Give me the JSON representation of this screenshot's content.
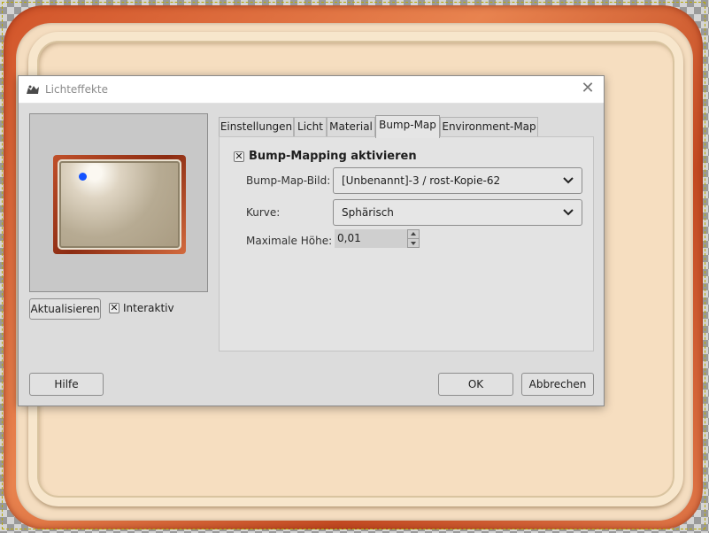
{
  "dialog": {
    "title": "Lichteffekte",
    "preview": {
      "update_label": "Aktualisieren",
      "interactive_label": "Interaktiv",
      "interactive_checked": true
    },
    "tabs": [
      {
        "label": "Einstellungen",
        "active": false
      },
      {
        "label": "Licht",
        "active": false
      },
      {
        "label": "Material",
        "active": false
      },
      {
        "label": "Bump-Map",
        "active": true
      },
      {
        "label": "Environment-Map",
        "active": false
      }
    ],
    "bump_map": {
      "enable_label": "Bump-Mapping aktivieren",
      "enable_checked": true,
      "image_label": "Bump-Map-Bild:",
      "image_value": "[Unbenannt]-3 / rost-Kopie-62",
      "curve_label": "Kurve:",
      "curve_value": "Sphärisch",
      "max_height_label": "Maximale Höhe:",
      "max_height_value": "0,01"
    },
    "buttons": {
      "help": "Hilfe",
      "ok": "OK",
      "cancel": "Abbrechen"
    }
  },
  "colors": {
    "dialog_bg": "#dcdcdc",
    "light_point": "#1453ff",
    "frame_rust": "#d2552a",
    "frame_cream": "#f4ddc0"
  },
  "icons": {
    "app": "gimp-icon",
    "close": "close-icon",
    "dropdown": "chevron-down-icon",
    "checkbox": "checkbox-checked-icon"
  }
}
